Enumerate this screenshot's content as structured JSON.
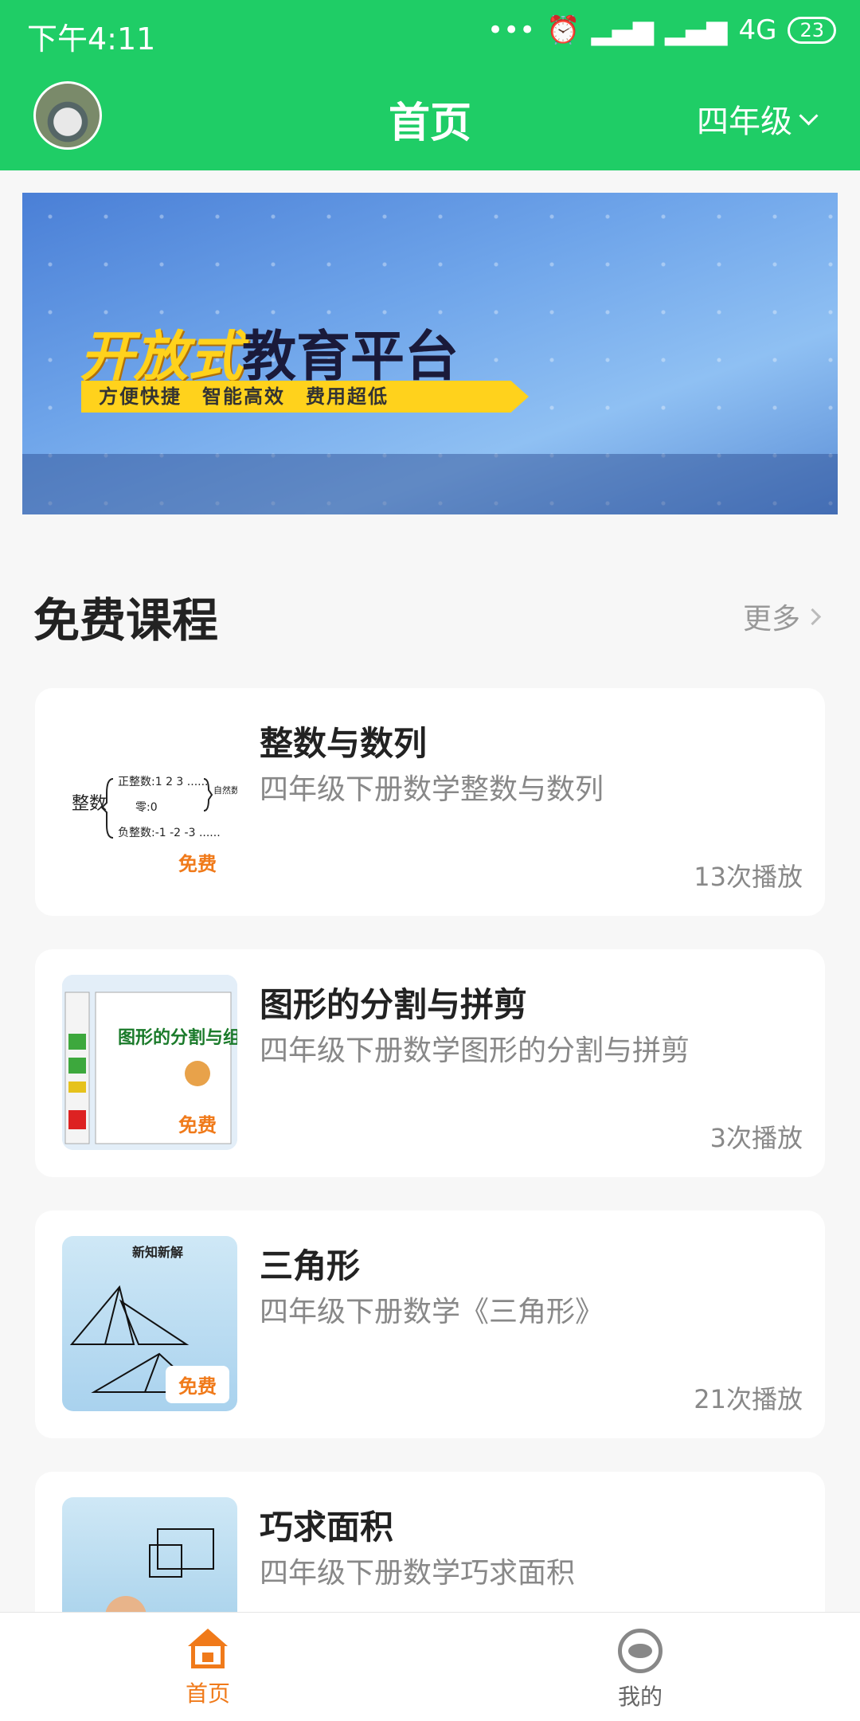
{
  "status": {
    "time": "下午4:11",
    "network": "4G",
    "battery": "23"
  },
  "header": {
    "title": "首页",
    "grade": "四年级"
  },
  "banner": {
    "title_yellow": "开放式",
    "title_dark": "教育平台",
    "subtitle": "方便快捷　智能高效　费用超低"
  },
  "section": {
    "title": "免费课程",
    "more": "更多"
  },
  "courses": [
    {
      "title": "整数与数列",
      "subtitle": "四年级下册数学整数与数列",
      "plays": "13次播放",
      "badge": "免费"
    },
    {
      "title": "图形的分割与拼剪",
      "subtitle": "四年级下册数学图形的分割与拼剪",
      "plays": "3次播放",
      "badge": "免费"
    },
    {
      "title": "三角形",
      "subtitle": "四年级下册数学《三角形》",
      "plays": "21次播放",
      "badge": "免费"
    },
    {
      "title": "巧求面积",
      "subtitle": "四年级下册数学巧求面积",
      "plays": "",
      "badge": ""
    }
  ],
  "nav": {
    "home": "首页",
    "me": "我的"
  },
  "colors": {
    "brand": "#1fcd66",
    "accent": "#f07a1a"
  }
}
